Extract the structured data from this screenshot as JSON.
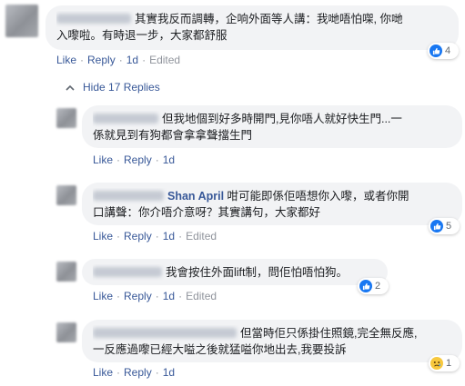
{
  "top_comment": {
    "text_line1": "其實我反而調轉，企响外面等人講：我哋唔怕㗎, 你哋",
    "text_line2": "入嚟啦。有時退一步，大家都舒服",
    "actions": {
      "like": "Like",
      "reply": "Reply",
      "time": "1d",
      "edited": "Edited"
    },
    "reaction_count": "4",
    "reaction_icon": "like-icon"
  },
  "hide_replies": {
    "label": "Hide 17 Replies",
    "icon": "chevron-up-icon"
  },
  "replies": [
    {
      "author": "",
      "text_line1": "但我地個到好多時開門,見你唔人就好快生門...一",
      "text_line2": "係就見到有狗都會拿拿聲擋生門",
      "actions": {
        "like": "Like",
        "reply": "Reply",
        "time": "1d",
        "edited": ""
      },
      "reaction_count": "",
      "reaction_icon": ""
    },
    {
      "author": "Shan April",
      "text_line1": "咁可能即係佢唔想你入嚟，或者你開",
      "text_line2": "口講聲：你介唔介意呀？其實講句，大家都好",
      "actions": {
        "like": "Like",
        "reply": "Reply",
        "time": "1d",
        "edited": "Edited"
      },
      "reaction_count": "5",
      "reaction_icon": "like-icon"
    },
    {
      "author": "",
      "text_line1": "我會按住外面lift制，問佢怕唔怕狗。",
      "text_line2": "",
      "actions": {
        "like": "Like",
        "reply": "Reply",
        "time": "1d",
        "edited": "Edited"
      },
      "reaction_count": "2",
      "reaction_icon": "like-icon"
    },
    {
      "author": "",
      "text_line1": "但當時佢只係掛住照鏡,完全無反應,",
      "text_line2": "一反應過嚟已經大嗌之後就猛嗌你地出去,我要投訴",
      "actions": {
        "like": "Like",
        "reply": "Reply",
        "time": "1d",
        "edited": ""
      },
      "reaction_count": "1",
      "reaction_icon": "sad-icon"
    }
  ],
  "colors": {
    "link": "#385898",
    "bubble": "#f2f3f5",
    "meta": "#90949c",
    "like_blue": "#1877f2",
    "sad_yellow": "#f7c83e"
  }
}
